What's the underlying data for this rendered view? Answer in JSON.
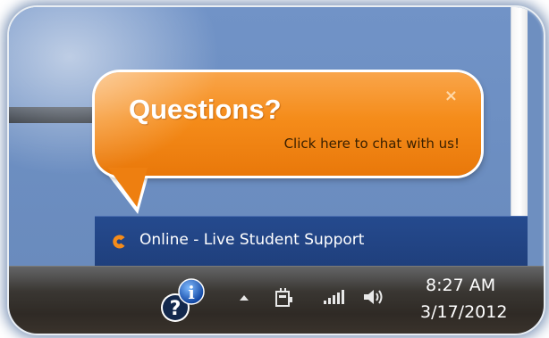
{
  "chat_popup": {
    "title": "Questions?",
    "subtitle": "Click here to chat with us!",
    "close_symbol": "×",
    "colors": {
      "bubble": "#f58c1a",
      "title": "#ffffff"
    }
  },
  "status_bar": {
    "icon": "chat-c-logo-icon",
    "text": "Online - Live Student Support",
    "colors": {
      "background": "#1f3f7c",
      "icon": "#f58c1a"
    }
  },
  "taskbar": {
    "tray_icons": [
      "info-question-icon",
      "show-hidden-icons-arrow",
      "power-plug-icon",
      "signal-bars-icon",
      "volume-icon"
    ],
    "clock": {
      "time": "8:27 AM",
      "date": "3/17/2012"
    }
  }
}
